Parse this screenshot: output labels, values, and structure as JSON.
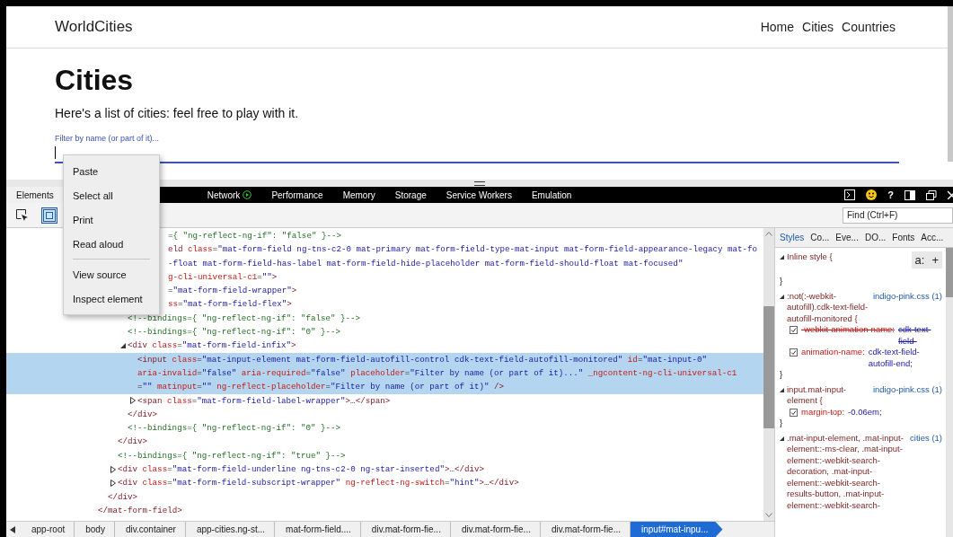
{
  "page": {
    "brand": "WorldCities",
    "nav": [
      {
        "label": "Home"
      },
      {
        "label": "Cities"
      },
      {
        "label": "Countries"
      }
    ],
    "heading": "Cities",
    "intro": "Here's a list of cities: feel free to play with it.",
    "filter": {
      "label": "Filter by name (or part of it)...",
      "focused": true
    }
  },
  "devtools": {
    "tabs": [
      {
        "label": "Elements",
        "selected": true
      },
      {
        "label": "Network",
        "selected": false,
        "recording": true
      },
      {
        "label": "Performance",
        "selected": false
      },
      {
        "label": "Memory",
        "selected": false
      },
      {
        "label": "Storage",
        "selected": false
      },
      {
        "label": "Service Workers",
        "selected": false
      },
      {
        "label": "Emulation",
        "selected": false
      }
    ],
    "help_label": "?",
    "tools": [
      {
        "kind": "pick",
        "selected": false
      },
      {
        "kind": "highlight",
        "selected": true
      }
    ],
    "find": {
      "placeholder": "Find (Ctrl+F)"
    },
    "dom": [
      {
        "partial": true,
        "selected": false,
        "lines": [
          [
            {
              "kind": "comment",
              "text": "={ \"ng-reflect-ng-if\": \"false\" }-->"
            }
          ]
        ]
      },
      {
        "partial": true,
        "selected": false,
        "lines": [
          [
            {
              "kind": "tag",
              "text": "eld"
            },
            {
              "kind": "attr",
              "text": " class"
            },
            {
              "kind": "punct",
              "text": "="
            },
            {
              "kind": "value",
              "text": "\"mat-form-field ng-tns-c2-0 mat-primary mat-form-field-type-mat-input mat-form-field-appearance-legacy mat-fo"
            }
          ],
          [
            {
              "kind": "value",
              "text": "-float mat-form-field-has-label mat-form-field-hide-placeholder mat-form-field-should-float mat-focused\""
            }
          ],
          [
            {
              "kind": "attr",
              "text": "g-cli-universal-c1"
            },
            {
              "kind": "punct",
              "text": "="
            },
            {
              "kind": "value",
              "text": "\"\""
            },
            {
              "kind": "tag",
              "text": ">"
            }
          ]
        ],
        "close": [
          {
            "kind": "tag",
            "text": "</mat-form-field>"
          }
        ],
        "children": [
          {
            "partial": true,
            "selected": false,
            "lines": [
              [
                {
                  "kind": "punct",
                  "text": "="
                },
                {
                  "kind": "value",
                  "text": "\"mat-form-field-wrapper\""
                },
                {
                  "kind": "tag",
                  "text": ">"
                }
              ]
            ],
            "close": [
              {
                "kind": "tag",
                "text": "</div>"
              }
            ],
            "children": [
              {
                "partial": true,
                "selected": false,
                "lines": [
                  [
                    {
                      "kind": "attr",
                      "text": "ss"
                    },
                    {
                      "kind": "punct",
                      "text": "="
                    },
                    {
                      "kind": "value",
                      "text": "\"mat-form-field-flex\""
                    },
                    {
                      "kind": "tag",
                      "text": ">"
                    }
                  ]
                ],
                "close": [
                  {
                    "kind": "tag",
                    "text": "</div>"
                  }
                ],
                "children": [
                  {
                    "selected": false,
                    "lines": [
                      [
                        {
                          "kind": "comment",
                          "text": "<!--bindings={ \"ng-reflect-ng-if\": \"false\" }-->"
                        }
                      ]
                    ]
                  },
                  {
                    "selected": false,
                    "lines": [
                      [
                        {
                          "kind": "comment",
                          "text": "<!--bindings={ \"ng-reflect-ng-if\": \"0\" }-->"
                        }
                      ]
                    ]
                  },
                  {
                    "selected": false,
                    "expanded": true,
                    "lines": [
                      [
                        {
                          "kind": "tag",
                          "text": "<div"
                        },
                        {
                          "kind": "attr",
                          "text": " class"
                        },
                        {
                          "kind": "punct",
                          "text": "="
                        },
                        {
                          "kind": "value",
                          "text": "\"mat-form-field-infix\""
                        },
                        {
                          "kind": "tag",
                          "text": ">"
                        }
                      ]
                    ],
                    "close": [
                      {
                        "kind": "tag",
                        "text": "</div>"
                      }
                    ],
                    "children": [
                      {
                        "selected": true,
                        "lines": [
                          [
                            {
                              "kind": "tag",
                              "text": "<input"
                            },
                            {
                              "kind": "attr",
                              "text": " class"
                            },
                            {
                              "kind": "punct",
                              "text": "="
                            },
                            {
                              "kind": "value",
                              "text": "\"mat-input-element mat-form-field-autofill-control cdk-text-field-autofill-monitored\""
                            },
                            {
                              "kind": "attr",
                              "text": " id"
                            },
                            {
                              "kind": "punct",
                              "text": "="
                            },
                            {
                              "kind": "value",
                              "text": "\"mat-input-0\""
                            }
                          ],
                          [
                            {
                              "kind": "attr",
                              "text": "aria-invalid"
                            },
                            {
                              "kind": "punct",
                              "text": "="
                            },
                            {
                              "kind": "value",
                              "text": "\"false\""
                            },
                            {
                              "kind": "attr",
                              "text": " aria-required"
                            },
                            {
                              "kind": "punct",
                              "text": "="
                            },
                            {
                              "kind": "value",
                              "text": "\"false\""
                            },
                            {
                              "kind": "attr",
                              "text": " placeholder"
                            },
                            {
                              "kind": "punct",
                              "text": "="
                            },
                            {
                              "kind": "value",
                              "text": "\"Filter by name (or part of it)...\""
                            },
                            {
                              "kind": "attr",
                              "text": " _ngcontent-ng-cli-universal-c1"
                            }
                          ],
                          [
                            {
                              "kind": "punct",
                              "text": "="
                            },
                            {
                              "kind": "value",
                              "text": "\"\""
                            },
                            {
                              "kind": "attr",
                              "text": " matinput"
                            },
                            {
                              "kind": "punct",
                              "text": "="
                            },
                            {
                              "kind": "value",
                              "text": "\"\""
                            },
                            {
                              "kind": "attr",
                              "text": " ng-reflect-placeholder"
                            },
                            {
                              "kind": "punct",
                              "text": "="
                            },
                            {
                              "kind": "value",
                              "text": "\"Filter by name (or part of it)\""
                            },
                            {
                              "kind": "tag",
                              "text": " />"
                            }
                          ]
                        ]
                      },
                      {
                        "selected": false,
                        "expanded": false,
                        "lines": [
                          [
                            {
                              "kind": "tag",
                              "text": "<span"
                            },
                            {
                              "kind": "attr",
                              "text": " class"
                            },
                            {
                              "kind": "punct",
                              "text": "="
                            },
                            {
                              "kind": "value",
                              "text": "\"mat-form-field-label-wrapper\""
                            },
                            {
                              "kind": "tag",
                              "text": ">"
                            },
                            {
                              "kind": "punct",
                              "text": "…"
                            },
                            {
                              "kind": "tag",
                              "text": "</span>"
                            }
                          ]
                        ]
                      }
                    ]
                  },
                  {
                    "selected": false,
                    "lines": [
                      [
                        {
                          "kind": "comment",
                          "text": "<!--bindings={ \"ng-reflect-ng-if\": \"0\" }-->"
                        }
                      ]
                    ]
                  }
                ]
              },
              {
                "selected": false,
                "lines": [
                  [
                    {
                      "kind": "comment",
                      "text": "<!--bindings={ \"ng-reflect-ng-if\": \"true\" }-->"
                    }
                  ]
                ]
              },
              {
                "selected": false,
                "expanded": false,
                "lines": [
                  [
                    {
                      "kind": "tag",
                      "text": "<div"
                    },
                    {
                      "kind": "attr",
                      "text": " class"
                    },
                    {
                      "kind": "punct",
                      "text": "="
                    },
                    {
                      "kind": "value",
                      "text": "\"mat-form-field-underline ng-tns-c2-0 ng-star-inserted\""
                    },
                    {
                      "kind": "tag",
                      "text": ">"
                    },
                    {
                      "kind": "punct",
                      "text": "…"
                    },
                    {
                      "kind": "tag",
                      "text": "</div>"
                    }
                  ]
                ]
              },
              {
                "selected": false,
                "expanded": false,
                "lines": [
                  [
                    {
                      "kind": "tag",
                      "text": "<div"
                    },
                    {
                      "kind": "attr",
                      "text": " class"
                    },
                    {
                      "kind": "punct",
                      "text": "="
                    },
                    {
                      "kind": "value",
                      "text": "\"mat-form-field-subscript-wrapper\""
                    },
                    {
                      "kind": "attr",
                      "text": " ng-reflect-ng-switch"
                    },
                    {
                      "kind": "punct",
                      "text": "="
                    },
                    {
                      "kind": "value",
                      "text": "\"hint\""
                    },
                    {
                      "kind": "tag",
                      "text": ">"
                    },
                    {
                      "kind": "punct",
                      "text": "…"
                    },
                    {
                      "kind": "tag",
                      "text": "</div>"
                    }
                  ]
                ]
              }
            ]
          }
        ]
      }
    ],
    "breadcrumb": [
      {
        "label": "app-root",
        "selected": false
      },
      {
        "label": "body",
        "selected": false
      },
      {
        "label": "div.container",
        "selected": false
      },
      {
        "label": "app-cities.ng-st...",
        "selected": false
      },
      {
        "label": "mat-form-field....",
        "selected": false
      },
      {
        "label": "div.mat-form-fie...",
        "selected": false
      },
      {
        "label": "div.mat-form-fie...",
        "selected": false
      },
      {
        "label": "div.mat-form-fie...",
        "selected": false
      },
      {
        "label": "input#mat-inpu...",
        "selected": true
      }
    ],
    "styles": {
      "tabs": [
        {
          "label": "Styles",
          "selected": true
        },
        {
          "label": "Co...",
          "selected": false
        },
        {
          "label": "Eve...",
          "selected": false
        },
        {
          "label": "DO...",
          "selected": false
        },
        {
          "label": "Fonts",
          "selected": false
        },
        {
          "label": "Acc...",
          "selected": false
        }
      ],
      "rules": [
        {
          "selector": "Inline style  {",
          "actions": [
            "a:",
            "+"
          ],
          "close": "}"
        },
        {
          "selector": ":not(:-webkit-autofill).cdk-text-field-autofill-monitored  {",
          "source": "indigo-pink.css (1)",
          "props": [
            {
              "checked": true,
              "overridden": true,
              "name": "-webkit-animation-name:",
              "value": "cdk-text-field-"
            },
            {
              "checked": true,
              "overridden": false,
              "name": "animation-name:",
              "value": "cdk-text-field-autofill-end;"
            }
          ],
          "close": "}"
        },
        {
          "selector": "input.mat-input-element  {",
          "source": "indigo-pink.css (1)",
          "props": [
            {
              "checked": true,
              "overridden": false,
              "name": "margin-top:",
              "value": "-0.06em;"
            }
          ],
          "close": "}"
        },
        {
          "selector": ".mat-input-element, .mat-input-element::-ms-clear, .mat-input-element::-webkit-search-decoration, .mat-input-element::-webkit-search-results-button, .mat-input-element::-webkit-search-",
          "source": "cities (1)"
        }
      ]
    }
  },
  "context_menu": {
    "groups": [
      [
        {
          "label": "Paste"
        },
        {
          "label": "Select all"
        },
        {
          "label": "Print"
        },
        {
          "label": "Read aloud"
        }
      ],
      [
        {
          "label": "View source"
        },
        {
          "label": "Inspect element"
        }
      ]
    ]
  }
}
